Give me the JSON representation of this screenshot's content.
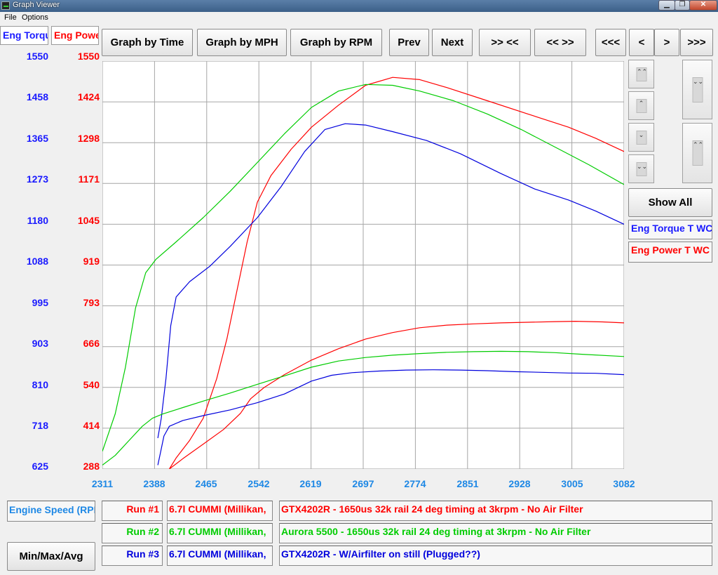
{
  "window": {
    "title": "Graph Viewer",
    "minimize": "▁",
    "restore": "❐",
    "close": "✕"
  },
  "menu": {
    "items": [
      "File",
      "Options"
    ]
  },
  "tabs": [
    {
      "label": "Eng Torque",
      "color": "#1a1aff"
    },
    {
      "label": "Eng Power",
      "color": "#ff0000"
    }
  ],
  "toolbar": {
    "graph_by_time": "Graph by Time",
    "graph_by_mph": "Graph by MPH",
    "graph_by_rpm": "Graph by RPM",
    "prev": "Prev",
    "next": "Next",
    "zoom_in": ">> <<",
    "zoom_out": "<< >>",
    "first": "<<<",
    "back": "<",
    "forward": ">",
    "last": ">>>"
  },
  "side_panel": {
    "scroll_top": "⌃⌃",
    "scroll_up": "⌃",
    "scroll_down": "⌄",
    "scroll_bottom": "⌄⌄",
    "page_up": "⌄⌄",
    "page_down": "⌃⌃",
    "show_all": "Show All",
    "series_labels": [
      {
        "label": "Eng Torque T WC",
        "color": "#1a1aff"
      },
      {
        "label": "Eng Power T WC",
        "color": "#ff0000"
      }
    ]
  },
  "bottom": {
    "x_channel": "Engine Speed (RPM)",
    "min_max_avg": "Min/Max/Avg",
    "runs": [
      {
        "run": "Run #1",
        "vehicle": "6.7l CUMMI (Millikan,",
        "description": "GTX4202R - 1650us 32k rail 24 deg timing at 3krpm - No Air Filter",
        "color": "#ff0000"
      },
      {
        "run": "Run #2",
        "vehicle": "6.7l CUMMI (Millikan,",
        "description": "Aurora 5500 - 1650us 32k rail 24 deg timing at 3krpm - No Air Filter",
        "color": "#00cc00"
      },
      {
        "run": "Run #3",
        "vehicle": "6.7l CUMMI (Millikan,",
        "description": "GTX4202R - W/Airfilter on still (Plugged??)",
        "color": "#0000dd"
      }
    ]
  },
  "chart_data": {
    "type": "line",
    "x_ticks": [
      "2311",
      "2388",
      "2465",
      "2542",
      "2619",
      "2697",
      "2774",
      "2851",
      "2928",
      "3005",
      "3082"
    ],
    "xlim": [
      2311,
      3082
    ],
    "torque_ticks": [
      "1550",
      "1458",
      "1365",
      "1273",
      "1180",
      "1088",
      "995",
      "903",
      "810",
      "718",
      "625"
    ],
    "torque_ylim": [
      625,
      1550
    ],
    "power_ticks": [
      "1550",
      "1424",
      "1298",
      "1171",
      "1045",
      "919",
      "793",
      "666",
      "540",
      "414",
      "288"
    ],
    "power_ylim": [
      288,
      1550
    ],
    "grid": true,
    "series": [
      {
        "run": "Run #1",
        "quantity": "Eng Torque",
        "axis": "torque",
        "color": "#ff0000",
        "points": [
          [
            2410,
            625
          ],
          [
            2420,
            650
          ],
          [
            2440,
            690
          ],
          [
            2460,
            740
          ],
          [
            2480,
            830
          ],
          [
            2495,
            920
          ],
          [
            2510,
            1030
          ],
          [
            2525,
            1140
          ],
          [
            2540,
            1230
          ],
          [
            2560,
            1290
          ],
          [
            2590,
            1350
          ],
          [
            2620,
            1400
          ],
          [
            2660,
            1450
          ],
          [
            2700,
            1495
          ],
          [
            2740,
            1513
          ],
          [
            2780,
            1508
          ],
          [
            2820,
            1490
          ],
          [
            2880,
            1460
          ],
          [
            2940,
            1430
          ],
          [
            3000,
            1400
          ],
          [
            3040,
            1375
          ],
          [
            3082,
            1345
          ]
        ]
      },
      {
        "run": "Run #2",
        "quantity": "Eng Torque",
        "axis": "torque",
        "color": "#00cc00",
        "points": [
          [
            2311,
            665
          ],
          [
            2330,
            750
          ],
          [
            2345,
            855
          ],
          [
            2360,
            990
          ],
          [
            2375,
            1070
          ],
          [
            2390,
            1100
          ],
          [
            2420,
            1140
          ],
          [
            2460,
            1195
          ],
          [
            2500,
            1255
          ],
          [
            2540,
            1320
          ],
          [
            2580,
            1385
          ],
          [
            2620,
            1445
          ],
          [
            2660,
            1482
          ],
          [
            2700,
            1497
          ],
          [
            2740,
            1495
          ],
          [
            2780,
            1482
          ],
          [
            2830,
            1460
          ],
          [
            2880,
            1430
          ],
          [
            2930,
            1395
          ],
          [
            2980,
            1355
          ],
          [
            3030,
            1315
          ],
          [
            3082,
            1270
          ]
        ]
      },
      {
        "run": "Run #3",
        "quantity": "Eng Torque",
        "axis": "torque",
        "color": "#0000dd",
        "points": [
          [
            2393,
            695
          ],
          [
            2398,
            740
          ],
          [
            2405,
            830
          ],
          [
            2412,
            950
          ],
          [
            2420,
            1015
          ],
          [
            2440,
            1050
          ],
          [
            2470,
            1085
          ],
          [
            2500,
            1130
          ],
          [
            2540,
            1195
          ],
          [
            2575,
            1265
          ],
          [
            2610,
            1345
          ],
          [
            2640,
            1395
          ],
          [
            2670,
            1408
          ],
          [
            2700,
            1405
          ],
          [
            2740,
            1390
          ],
          [
            2790,
            1370
          ],
          [
            2840,
            1340
          ],
          [
            2900,
            1295
          ],
          [
            2950,
            1260
          ],
          [
            3000,
            1235
          ],
          [
            3040,
            1210
          ],
          [
            3082,
            1180
          ]
        ]
      },
      {
        "run": "Run #1",
        "quantity": "Eng Power",
        "axis": "power",
        "color": "#ff0000",
        "points": [
          [
            2410,
            288
          ],
          [
            2430,
            320
          ],
          [
            2460,
            365
          ],
          [
            2490,
            410
          ],
          [
            2515,
            460
          ],
          [
            2530,
            505
          ],
          [
            2550,
            540
          ],
          [
            2580,
            580
          ],
          [
            2620,
            625
          ],
          [
            2660,
            660
          ],
          [
            2700,
            690
          ],
          [
            2740,
            710
          ],
          [
            2780,
            725
          ],
          [
            2820,
            733
          ],
          [
            2860,
            737
          ],
          [
            2900,
            740
          ],
          [
            2940,
            742
          ],
          [
            2980,
            744
          ],
          [
            3010,
            745
          ],
          [
            3050,
            743
          ],
          [
            3082,
            740
          ]
        ]
      },
      {
        "run": "Run #2",
        "quantity": "Eng Power",
        "axis": "power",
        "color": "#00cc00",
        "points": [
          [
            2311,
            300
          ],
          [
            2330,
            330
          ],
          [
            2350,
            375
          ],
          [
            2370,
            420
          ],
          [
            2385,
            445
          ],
          [
            2400,
            458
          ],
          [
            2430,
            478
          ],
          [
            2460,
            498
          ],
          [
            2500,
            523
          ],
          [
            2540,
            550
          ],
          [
            2580,
            576
          ],
          [
            2620,
            603
          ],
          [
            2660,
            622
          ],
          [
            2700,
            633
          ],
          [
            2740,
            640
          ],
          [
            2780,
            645
          ],
          [
            2820,
            649
          ],
          [
            2860,
            651
          ],
          [
            2900,
            652
          ],
          [
            2940,
            651
          ],
          [
            2980,
            648
          ],
          [
            3020,
            643
          ],
          [
            3082,
            636
          ]
        ]
      },
      {
        "run": "Run #3",
        "quantity": "Eng Power",
        "axis": "power",
        "color": "#0000dd",
        "points": [
          [
            2393,
            300
          ],
          [
            2397,
            340
          ],
          [
            2402,
            390
          ],
          [
            2410,
            420
          ],
          [
            2430,
            438
          ],
          [
            2460,
            453
          ],
          [
            2500,
            471
          ],
          [
            2540,
            493
          ],
          [
            2580,
            520
          ],
          [
            2620,
            560
          ],
          [
            2650,
            578
          ],
          [
            2680,
            586
          ],
          [
            2720,
            591
          ],
          [
            2760,
            594
          ],
          [
            2800,
            595
          ],
          [
            2840,
            594
          ],
          [
            2880,
            592
          ],
          [
            2920,
            589
          ],
          [
            2960,
            587
          ],
          [
            3000,
            585
          ],
          [
            3040,
            584
          ],
          [
            3082,
            580
          ]
        ]
      }
    ]
  }
}
